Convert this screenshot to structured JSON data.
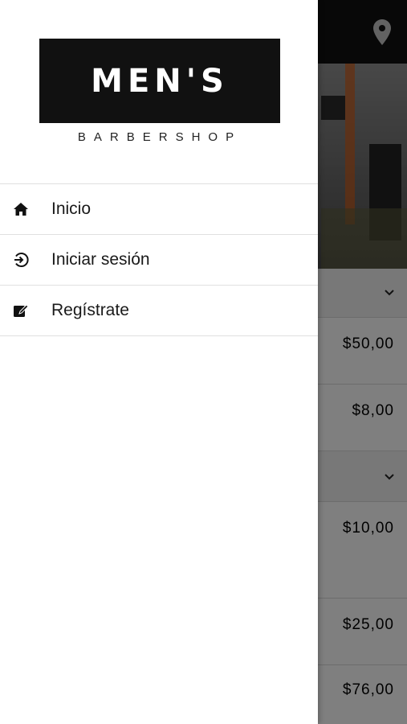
{
  "drawer": {
    "logo_title": "MEN'S",
    "logo_subtitle": "BARBERSHOP",
    "items": [
      {
        "label": "Inicio",
        "icon": "home-icon"
      },
      {
        "label": "Iniciar sesión",
        "icon": "login-icon"
      },
      {
        "label": "Regístrate",
        "icon": "edit-icon"
      }
    ]
  },
  "background": {
    "topbar_icon": "location-pin-icon",
    "prices": [
      "$50,00",
      "$8,00",
      "$10,00",
      "$25,00",
      "$76,00"
    ]
  },
  "colors": {
    "drawer_bg": "#ffffff",
    "logo_bg": "#111111",
    "scrim": "rgba(0,0,0,0.48)"
  }
}
